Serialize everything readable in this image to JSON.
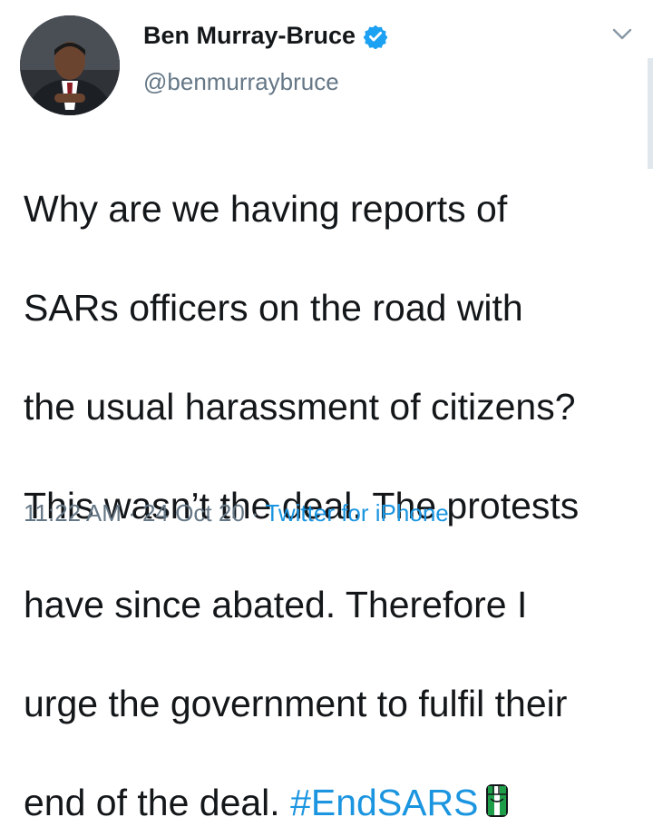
{
  "author": {
    "name": "Ben Murray-Bruce",
    "handle": "@benmurraybruce",
    "verified": true
  },
  "tweet": {
    "text_lines": [
      "Why are we having reports of",
      "SARs officers on the road with",
      "the usual harassment of citizens?",
      "This wasn’t the deal. The protests",
      "have since abated. Therefore I",
      "urge the government to fulfil their",
      "end of the deal. "
    ],
    "hashtag": "#EndSARS",
    "emoji_icon": "raised-fist-nigeria-icon"
  },
  "meta": {
    "time": "11:22 AM",
    "sep1": " · ",
    "date": "24 Oct 20",
    "sep2": " · ",
    "source": "Twitter for iPhone"
  },
  "icons": {
    "verified": "verified-badge-icon",
    "more": "chevron-down-icon"
  },
  "colors": {
    "link": "#1b95e0",
    "secondary": "#657786",
    "verified": "#1da1f2",
    "text": "#14171a"
  }
}
